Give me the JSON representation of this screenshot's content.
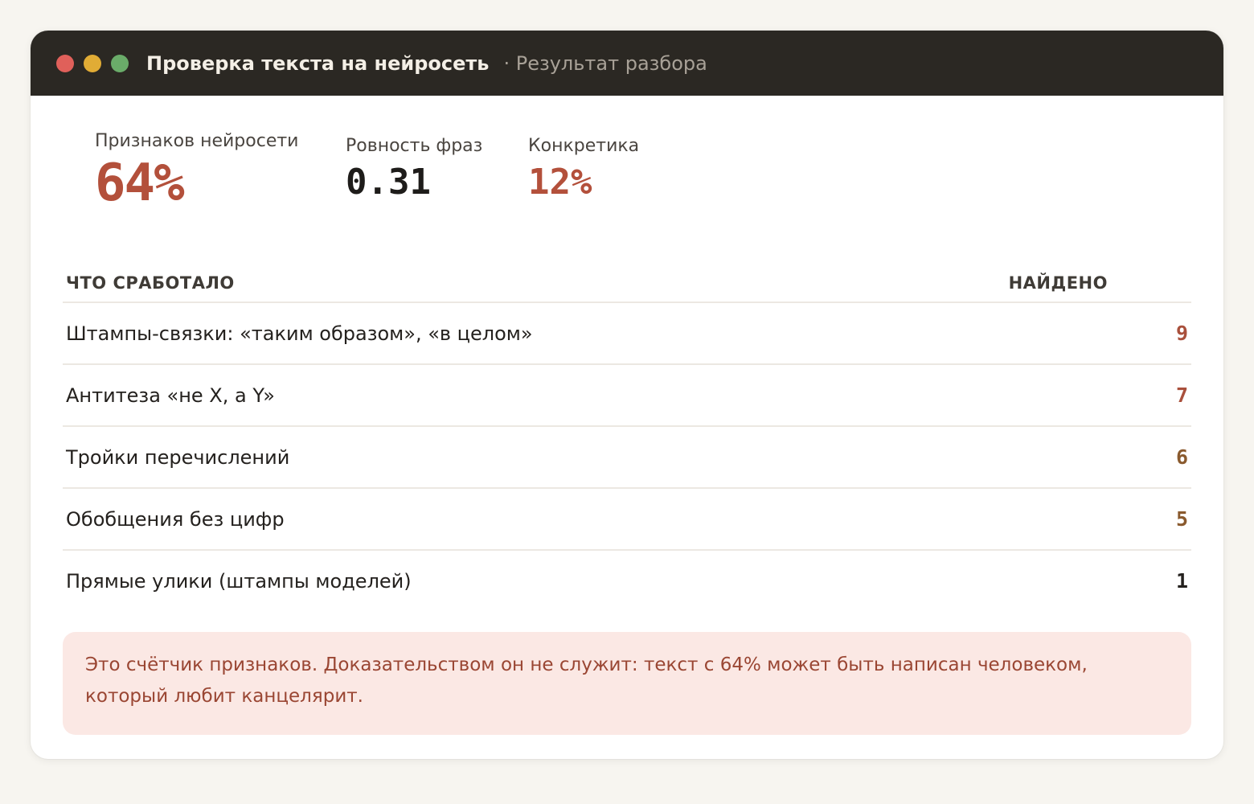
{
  "window": {
    "title": "Проверка текста на нейросеть",
    "subtitle": "· Результат разбора"
  },
  "stats": [
    {
      "label": "Признаков нейросети",
      "value": "64%",
      "color": "#b3503b"
    },
    {
      "label": "Ровность фраз",
      "value": "0.31",
      "color": "#1e1c1a"
    },
    {
      "label": "Конкретика",
      "value": "12%",
      "color": "#b3503b"
    }
  ],
  "table": {
    "headers": {
      "trigger": "ЧТО СРАБОТАЛО",
      "found": "НАЙДЕНО"
    },
    "rows": [
      {
        "label": "Штампы-связки: «таким образом», «в целом»",
        "count": "9",
        "color": "#a9503c"
      },
      {
        "label": "Антитеза «не X, а Y»",
        "count": "7",
        "color": "#a9503c"
      },
      {
        "label": "Тройки перечислений",
        "count": "6",
        "color": "#8a5a2e"
      },
      {
        "label": "Обобщения без цифр",
        "count": "5",
        "color": "#8a5a2e"
      },
      {
        "label": "Прямые улики (штампы моделей)",
        "count": "1",
        "color": "#24211e"
      }
    ]
  },
  "note": {
    "text": "Это счётчик признаков. Доказательством он не служит: текст с 64% может быть написан человеком, который любит канцелярит."
  }
}
